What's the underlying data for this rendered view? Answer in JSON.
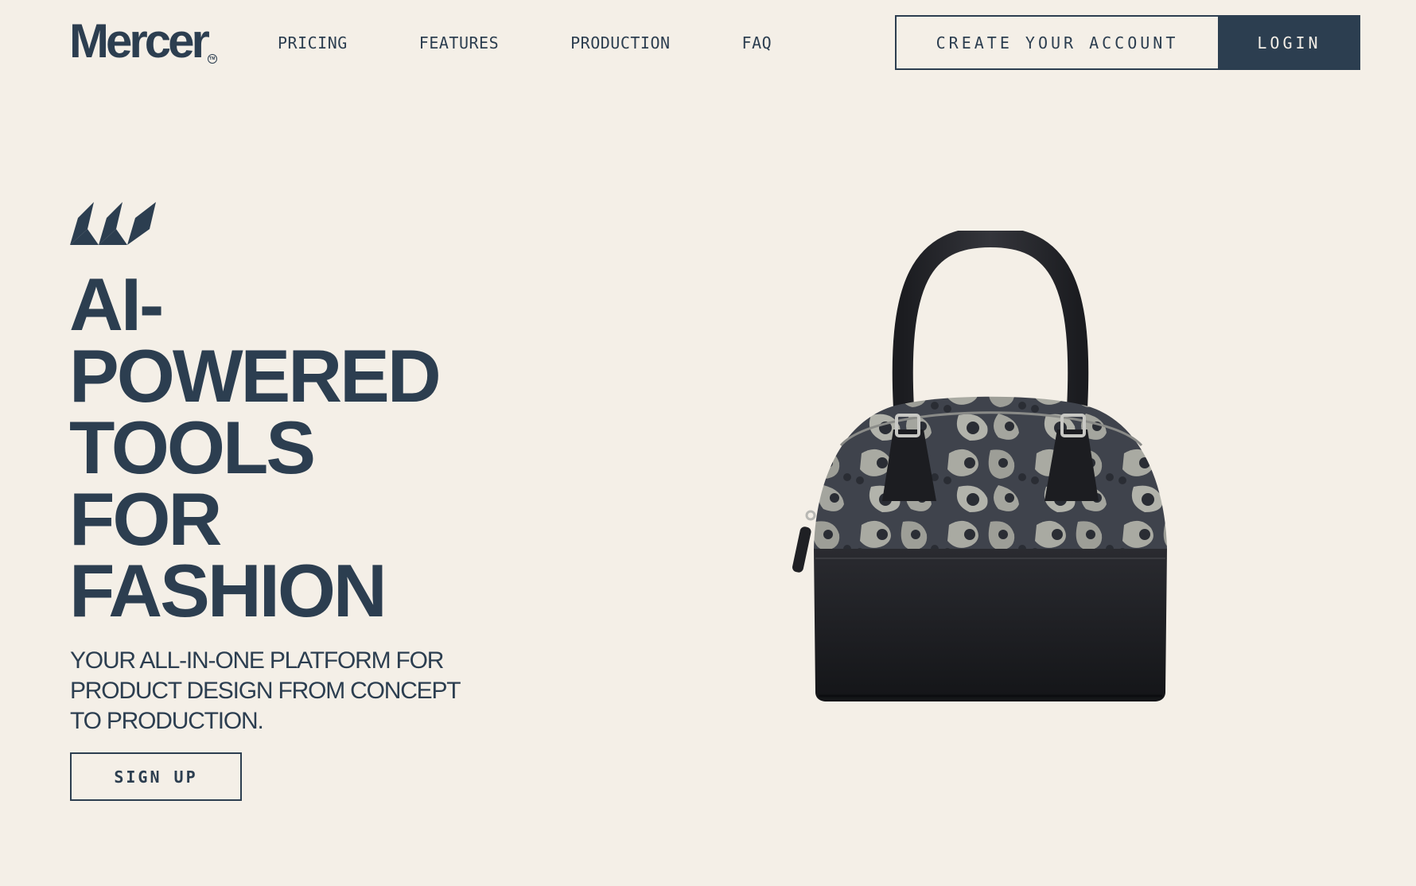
{
  "header": {
    "logo_text": "Mercer",
    "logo_tm": "TM",
    "nav": [
      {
        "label": "PRICING"
      },
      {
        "label": "FEATURES"
      },
      {
        "label": "PRODUCTION"
      },
      {
        "label": "FAQ"
      }
    ],
    "create_account_label": "CREATE YOUR ACCOUNT",
    "login_label": "LOGIN"
  },
  "hero": {
    "mark_icon": "mercer-stripes-icon",
    "title_lines": [
      "AI-",
      "POWERED",
      "TOOLS",
      "FOR",
      "FASHION"
    ],
    "subtitle": "YOUR ALL-IN-ONE PLATFORM FOR PRODUCT DESIGN FROM CONCEPT TO PRODUCTION.",
    "signup_label": "SIGN UP",
    "product_image": "leopard-print-handbag"
  },
  "colors": {
    "background": "#f4efe7",
    "primary": "#2c3e50",
    "button_text_on_primary": "#f4efe7"
  }
}
